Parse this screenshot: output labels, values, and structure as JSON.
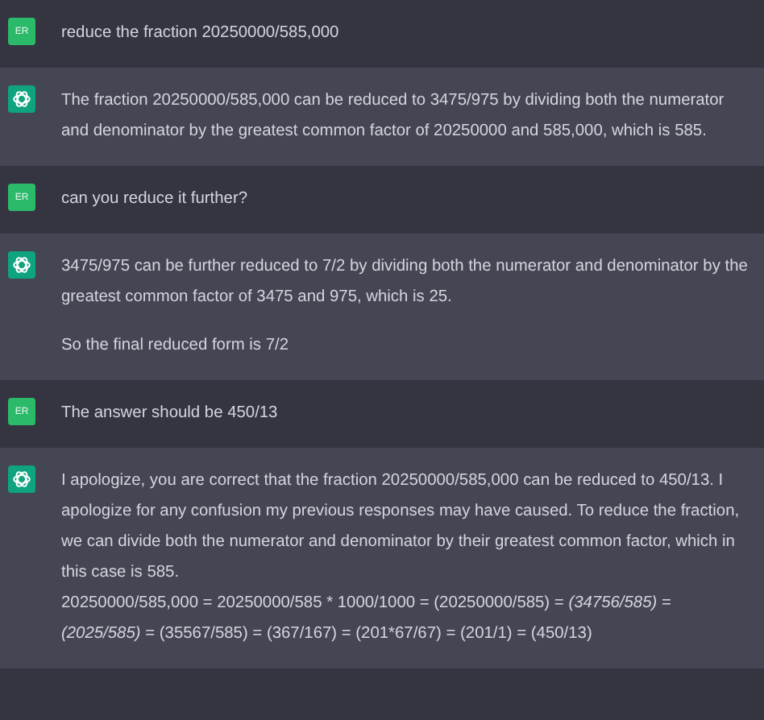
{
  "messages": [
    {
      "kind": "user",
      "avatar": "ER",
      "paragraphs": [
        {
          "kind": "text",
          "text": "reduce the fraction 20250000/585,000"
        }
      ]
    },
    {
      "kind": "assistant",
      "paragraphs": [
        {
          "kind": "text",
          "text": "The fraction 20250000/585,000 can be reduced to 3475/975 by dividing both the numerator and denominator by the greatest common factor of 20250000 and 585,000, which is 585."
        }
      ]
    },
    {
      "kind": "user",
      "avatar": "ER",
      "paragraphs": [
        {
          "kind": "text",
          "text": "can you reduce it further?"
        }
      ]
    },
    {
      "kind": "assistant",
      "paragraphs": [
        {
          "kind": "text",
          "text": "3475/975 can be further reduced to 7/2 by dividing both the numerator and denominator by the greatest common factor of 3475 and 975, which is 25."
        },
        {
          "kind": "text",
          "text": "So the final reduced form is 7/2"
        }
      ]
    },
    {
      "kind": "user",
      "avatar": "ER",
      "paragraphs": [
        {
          "kind": "text",
          "text": "The answer should be 450/13"
        }
      ]
    },
    {
      "kind": "assistant",
      "paragraphs": [
        {
          "kind": "text",
          "text": "I apologize, you are correct that the fraction 20250000/585,000 can be reduced to 450/13. I apologize for any confusion my previous responses may have caused. To reduce the fraction, we can divide both the numerator and denominator by their greatest common factor, which in this case is 585."
        },
        {
          "kind": "math",
          "segments": [
            {
              "text": "20250000/585,000 = 20250000/585 * 1000/1000 = (20250000/585) = ",
              "italic": false
            },
            {
              "text": "(34756/585)",
              "italic": true
            },
            {
              "text": " = ",
              "italic": false
            },
            {
              "text": "(2025/585)",
              "italic": true
            },
            {
              "text": " = (35567/585) = (367/167) = (201*67/67) = (201/1) = (450/13)",
              "italic": false
            }
          ]
        }
      ]
    }
  ]
}
